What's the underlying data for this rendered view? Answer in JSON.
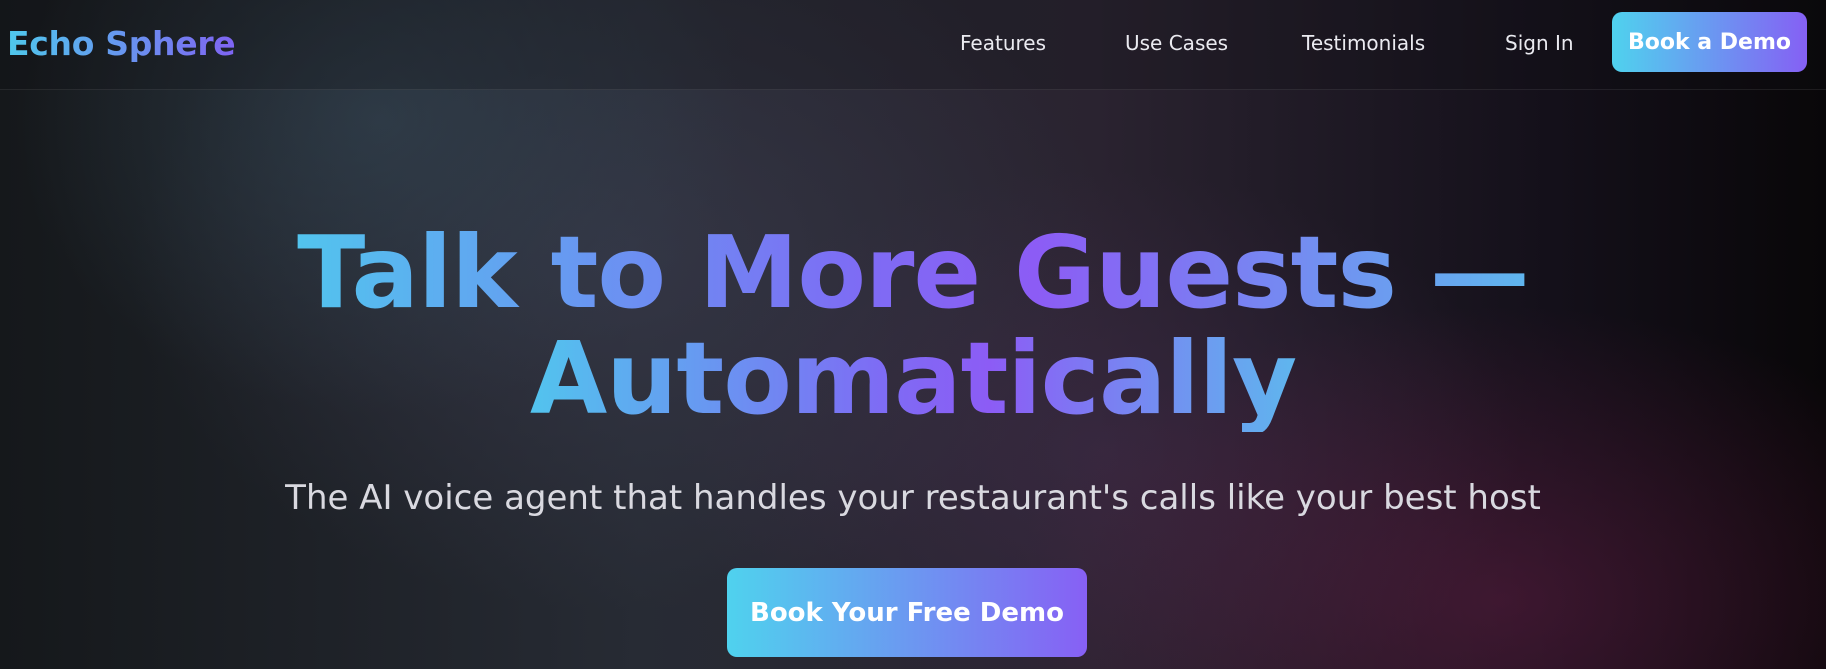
{
  "brand": {
    "name": "Echo Sphere"
  },
  "nav": {
    "links": [
      {
        "label": "Features"
      },
      {
        "label": "Use Cases"
      },
      {
        "label": "Testimonials"
      },
      {
        "label": "Sign In"
      }
    ],
    "cta_label": "Book a Demo"
  },
  "hero": {
    "headline_line1": "Talk to More Guests —",
    "headline_line2": "Automatically",
    "subtitle": "The AI voice agent that handles your restaurant's calls like your best host",
    "cta_label": "Book Your Free Demo"
  },
  "colors": {
    "accent_start": "#4fd2ee",
    "accent_end": "#8560f4",
    "background": "#101114"
  }
}
